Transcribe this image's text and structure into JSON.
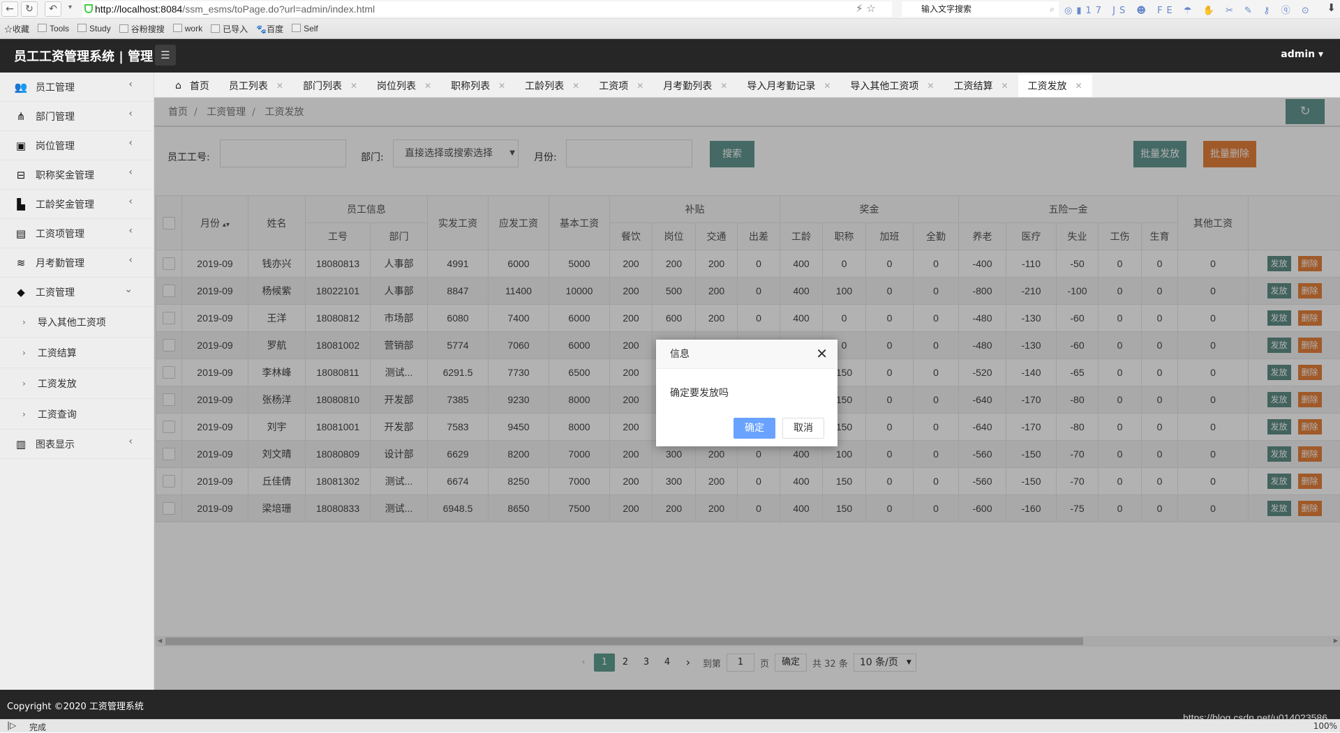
{
  "browser": {
    "url_host": "http://localhost:8084",
    "url_path": "/ssm_esms/toPage.do?url=admin/index.html",
    "search_placeholder": "输入文字搜索",
    "bookmarks": [
      "收藏",
      "Tools",
      "Study",
      "谷粉搜搜",
      "work",
      "已导入",
      "百度",
      "Self"
    ],
    "status": "完成",
    "zoom": "100%"
  },
  "header": {
    "title": "员工工资管理系统 | 管理",
    "user": "admin"
  },
  "sidebar": {
    "items": [
      {
        "label": "员工管理",
        "icon": "users-icon"
      },
      {
        "label": "部门管理",
        "icon": "sitemap-icon"
      },
      {
        "label": "岗位管理",
        "icon": "id-card-icon"
      },
      {
        "label": "职称奖金管理",
        "icon": "briefcase-icon"
      },
      {
        "label": "工龄奖金管理",
        "icon": "building-icon"
      },
      {
        "label": "工资项管理",
        "icon": "money-icon"
      },
      {
        "label": "月考勤管理",
        "icon": "layers-icon"
      },
      {
        "label": "工资管理",
        "icon": "tag-icon",
        "expanded": true,
        "children": [
          "导入其他工资项",
          "工资结算",
          "工资发放",
          "工资查询"
        ]
      },
      {
        "label": "图表显示",
        "icon": "report-icon"
      }
    ]
  },
  "tabs": [
    {
      "label": "首页"
    },
    {
      "label": "员工列表"
    },
    {
      "label": "部门列表"
    },
    {
      "label": "岗位列表"
    },
    {
      "label": "职称列表"
    },
    {
      "label": "工龄列表"
    },
    {
      "label": "工资项"
    },
    {
      "label": "月考勤列表"
    },
    {
      "label": "导入月考勤记录"
    },
    {
      "label": "导入其他工资项"
    },
    {
      "label": "工资结算"
    },
    {
      "label": "工资发放",
      "active": true
    }
  ],
  "breadcrumb": [
    "首页",
    "工资管理",
    "工资发放"
  ],
  "filters": {
    "emp_no_label": "员工工号:",
    "emp_no_value": "",
    "dept_label": "部门:",
    "dept_placeholder": "直接选择或搜索选择",
    "month_label": "月份:",
    "month_value": "",
    "search": "搜索",
    "batch_pay": "批量发放",
    "batch_delete": "批量删除"
  },
  "table": {
    "groups": {
      "month": "月份",
      "name": "姓名",
      "emp_info": "员工信息",
      "actual": "实发工资",
      "gross": "应发工资",
      "base": "基本工资",
      "subsidy": "补贴",
      "bonus": "奖金",
      "insurance": "五险一金",
      "other": "其他工资"
    },
    "sub": [
      "工号",
      "部门",
      "餐饮",
      "岗位",
      "交通",
      "出差",
      "工龄",
      "职称",
      "加班",
      "全勤",
      "养老",
      "医疗",
      "失业",
      "工伤",
      "生育"
    ],
    "rows": [
      [
        "2019-09",
        "钱亦兴",
        "18080813",
        "人事部",
        "4991",
        "6000",
        "5000",
        "200",
        "200",
        "200",
        "0",
        "400",
        "0",
        "0",
        "0",
        "-400",
        "-110",
        "-50",
        "0",
        "0",
        "0"
      ],
      [
        "2019-09",
        "杨候紫",
        "18022101",
        "人事部",
        "8847",
        "11400",
        "10000",
        "200",
        "500",
        "200",
        "0",
        "400",
        "100",
        "0",
        "0",
        "-800",
        "-210",
        "-100",
        "0",
        "0",
        "0"
      ],
      [
        "2019-09",
        "王洋",
        "18080812",
        "市场部",
        "6080",
        "7400",
        "6000",
        "200",
        "600",
        "200",
        "0",
        "400",
        "0",
        "0",
        "0",
        "-480",
        "-130",
        "-60",
        "0",
        "0",
        "0"
      ],
      [
        "2019-09",
        "罗航",
        "18081002",
        "营销部",
        "5774",
        "7060",
        "6000",
        "200",
        "",
        "",
        "",
        "",
        "0",
        "0",
        "0",
        "-480",
        "-130",
        "-60",
        "0",
        "0",
        "0"
      ],
      [
        "2019-09",
        "李林峰",
        "18080811",
        "测试...",
        "6291.5",
        "7730",
        "6500",
        "200",
        "",
        "",
        "",
        "",
        "150",
        "0",
        "0",
        "-520",
        "-140",
        "-65",
        "0",
        "0",
        "0"
      ],
      [
        "2019-09",
        "张杨洋",
        "18080810",
        "开发部",
        "7385",
        "9230",
        "8000",
        "200",
        "",
        "",
        "",
        "",
        "150",
        "0",
        "0",
        "-640",
        "-170",
        "-80",
        "0",
        "0",
        "0"
      ],
      [
        "2019-09",
        "刘宇",
        "18081001",
        "开发部",
        "7583",
        "9450",
        "8000",
        "200",
        "",
        "",
        "",
        "",
        "150",
        "0",
        "0",
        "-640",
        "-170",
        "-80",
        "0",
        "0",
        "0"
      ],
      [
        "2019-09",
        "刘文晴",
        "18080809",
        "设计部",
        "6629",
        "8200",
        "7000",
        "200",
        "300",
        "200",
        "0",
        "400",
        "100",
        "0",
        "0",
        "-560",
        "-150",
        "-70",
        "0",
        "0",
        "0"
      ],
      [
        "2019-09",
        "丘佳倩",
        "18081302",
        "测试...",
        "6674",
        "8250",
        "7000",
        "200",
        "300",
        "200",
        "0",
        "400",
        "150",
        "0",
        "0",
        "-560",
        "-150",
        "-70",
        "0",
        "0",
        "0"
      ],
      [
        "2019-09",
        "梁培珊",
        "18080833",
        "测试...",
        "6948.5",
        "8650",
        "7500",
        "200",
        "200",
        "200",
        "0",
        "400",
        "150",
        "0",
        "0",
        "-600",
        "-160",
        "-75",
        "0",
        "0",
        "0"
      ]
    ],
    "pay": "发放",
    "delete": "删除"
  },
  "pager": {
    "pages": [
      "1",
      "2",
      "3",
      "4"
    ],
    "current": "1",
    "goto_label": "到第",
    "goto_value": "1",
    "page_unit": "页",
    "confirm": "确定",
    "total": "共 32 条",
    "page_size": "10 条/页"
  },
  "dialog": {
    "title": "信息",
    "message": "确定要发放吗",
    "ok": "确定",
    "cancel": "取消"
  },
  "footer": {
    "copyright": "Copyright ©2020 工资管理系统",
    "watermark": "https://blog.csdn.net/u014023586"
  },
  "colors": {
    "teal": "#5f8f86",
    "orange": "#e5813c",
    "dialog_ok": "#6aa3ff",
    "header": "#262626"
  }
}
